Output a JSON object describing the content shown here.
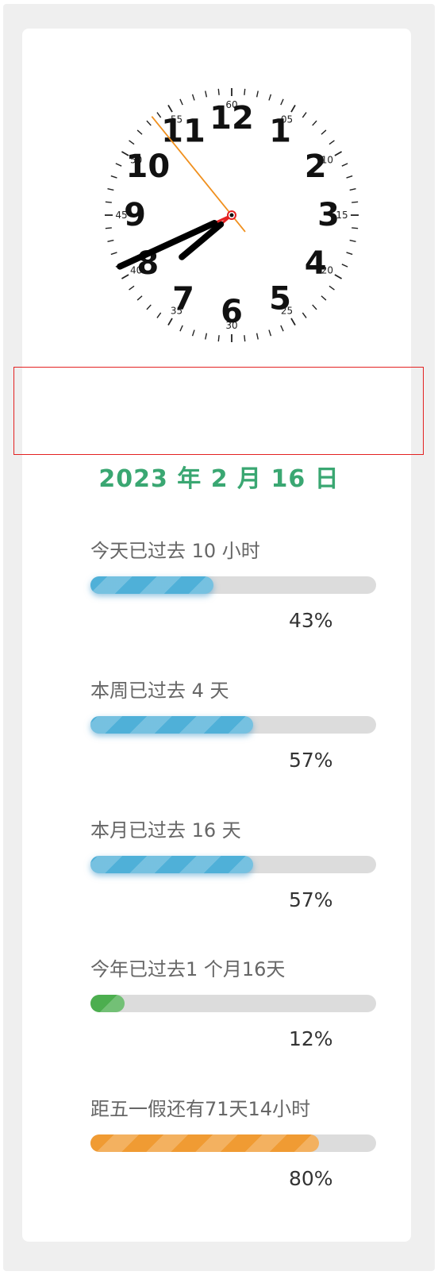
{
  "clock": {
    "hour_numbers": [
      "12",
      "1",
      "2",
      "3",
      "4",
      "5",
      "6",
      "7",
      "8",
      "9",
      "10",
      "11"
    ],
    "minute_labels": [
      "60",
      "05",
      "10",
      "15",
      "20",
      "25",
      "30",
      "35",
      "40",
      "45",
      "50",
      "55"
    ],
    "time": {
      "hour": 7,
      "minute": 40,
      "second": 53.5
    },
    "colors": {
      "hands": "#000000",
      "second_hand": "#f0901e",
      "center": "#e32222"
    }
  },
  "date": {
    "text": "2023 年 2 月 16 日",
    "color": "#3aa772"
  },
  "progress": [
    {
      "label": "今天已过去 10 小时",
      "percent_text": "43%",
      "fraction": 0.43,
      "color": "#4fb0d8"
    },
    {
      "label": "本周已过去 4 天",
      "percent_text": "57%",
      "fraction": 0.57,
      "color": "#4fb0d8"
    },
    {
      "label": "本月已过去 16 天",
      "percent_text": "57%",
      "fraction": 0.57,
      "color": "#4fb0d8"
    },
    {
      "label": "今年已过去1 个月16天",
      "percent_text": "12%",
      "fraction": 0.12,
      "color": "#4cae4f"
    },
    {
      "label": "距五一假还有71天14小时",
      "percent_text": "80%",
      "fraction": 0.8,
      "color": "#f09b33"
    }
  ]
}
